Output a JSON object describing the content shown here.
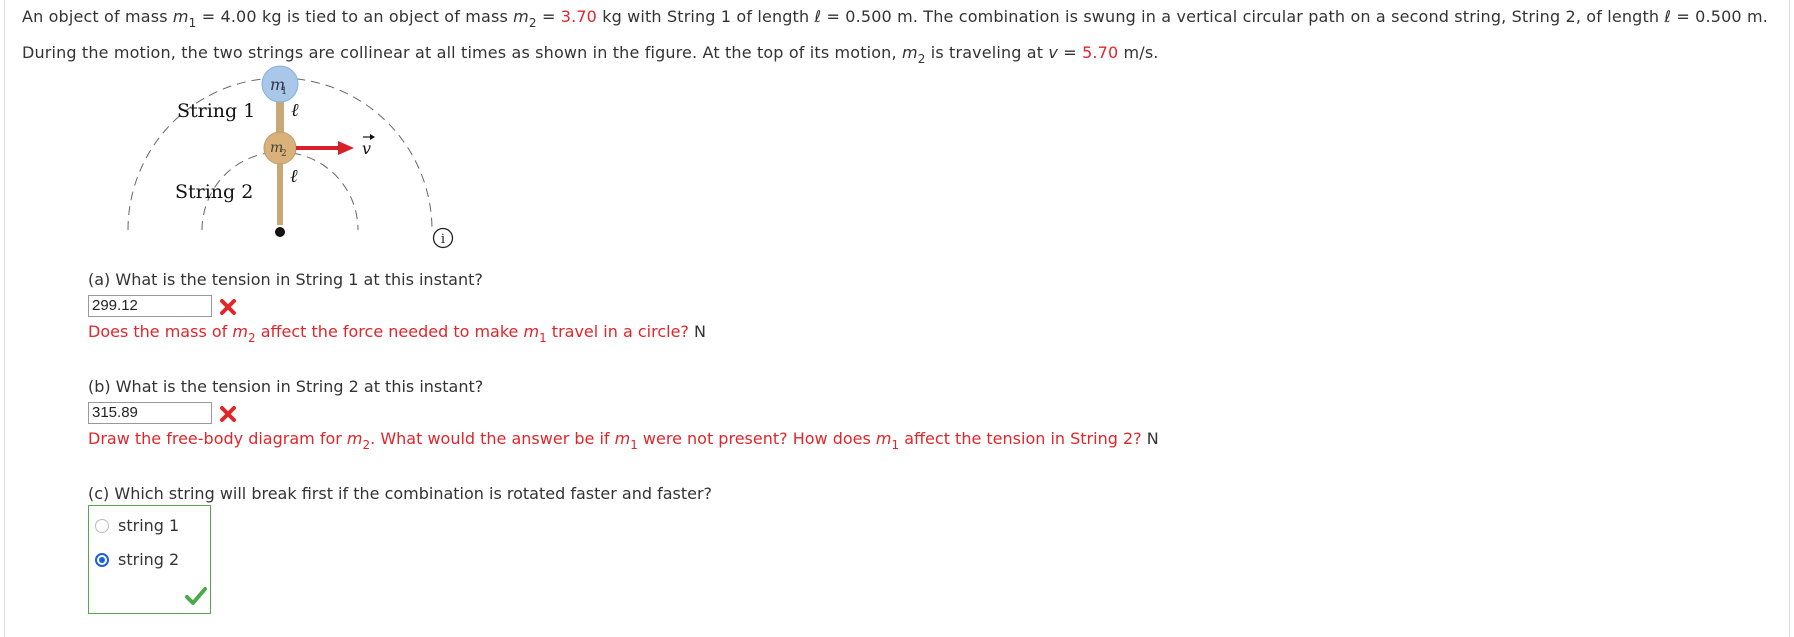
{
  "problem": {
    "p1": "An object of mass ",
    "m1": "m",
    "m1_sub": "1",
    "p2": " = 4.00 kg is tied to an object of mass ",
    "m2": "m",
    "m2_sub": "2",
    "p3": " = ",
    "m2_value": "3.70",
    "p4": " kg with String 1 of length ",
    "ell1": "ℓ",
    "p5": " = 0.500 m. The combination is swung in a vertical circular path on a second string, String 2, of length ",
    "ell2": "ℓ",
    "p6": " = 0.500 m. During the motion, the two strings are collinear at all times as shown in the figure. At the top of its motion, ",
    "m2b": "m",
    "m2b_sub": "2",
    "p7": " is traveling at ",
    "v": "v",
    "p8": " = ",
    "v_value": "5.70",
    "p9": " m/s."
  },
  "figure": {
    "m1_label": "m",
    "m1_sub": "1",
    "m2_label": "m",
    "m2_sub": "2",
    "string1_label": "String 1",
    "string2_label": "String 2",
    "ell_top": "ℓ",
    "ell_bottom": "ℓ",
    "v_label": "v",
    "colors": {
      "m1": "#a9c7e8",
      "m2": "#d8b27a",
      "arrow": "#d6202a",
      "rod": "#c8a877"
    }
  },
  "questions": {
    "a": {
      "prompt": "(a) What is the tension in String 1 at this instant?",
      "value": "299.12",
      "hint_p1": "Does the mass of ",
      "hint_m": "m",
      "hint_m_sub": "2",
      "hint_p2": " affect the force needed to make ",
      "hint_m2": "m",
      "hint_m2_sub": "1",
      "hint_p3": " travel in a circle?",
      "unit": " N"
    },
    "b": {
      "prompt": "(b) What is the tension in String 2 at this instant?",
      "value": "315.89",
      "hint_p1": "Draw the free-body diagram for ",
      "hint_m": "m",
      "hint_m_sub": "2",
      "hint_p2": ". What would the answer be if ",
      "hint_m2": "m",
      "hint_m2_sub": "1",
      "hint_p3": " were not present? How does ",
      "hint_m3": "m",
      "hint_m3_sub": "1",
      "hint_p4": " affect the tension in String 2?",
      "unit": " N"
    },
    "c": {
      "prompt": "(c) Which string will break first if the combination is rotated faster and faster?",
      "options": [
        "string 1",
        "string 2"
      ],
      "selected": "string 2"
    }
  },
  "icons": {
    "info": "info-icon",
    "wrong": "x-mark-icon",
    "correct": "check-mark-icon"
  }
}
